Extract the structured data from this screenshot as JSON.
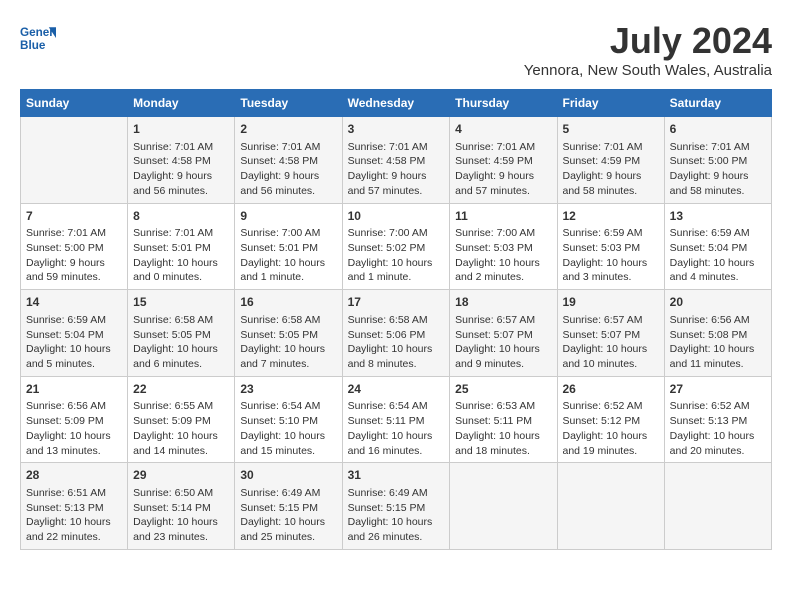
{
  "logo": {
    "line1": "General",
    "line2": "Blue"
  },
  "title": "July 2024",
  "location": "Yennora, New South Wales, Australia",
  "headers": [
    "Sunday",
    "Monday",
    "Tuesday",
    "Wednesday",
    "Thursday",
    "Friday",
    "Saturday"
  ],
  "weeks": [
    [
      {
        "day": "",
        "sunrise": "",
        "sunset": "",
        "daylight": ""
      },
      {
        "day": "1",
        "sunrise": "Sunrise: 7:01 AM",
        "sunset": "Sunset: 4:58 PM",
        "daylight": "Daylight: 9 hours and 56 minutes."
      },
      {
        "day": "2",
        "sunrise": "Sunrise: 7:01 AM",
        "sunset": "Sunset: 4:58 PM",
        "daylight": "Daylight: 9 hours and 56 minutes."
      },
      {
        "day": "3",
        "sunrise": "Sunrise: 7:01 AM",
        "sunset": "Sunset: 4:58 PM",
        "daylight": "Daylight: 9 hours and 57 minutes."
      },
      {
        "day": "4",
        "sunrise": "Sunrise: 7:01 AM",
        "sunset": "Sunset: 4:59 PM",
        "daylight": "Daylight: 9 hours and 57 minutes."
      },
      {
        "day": "5",
        "sunrise": "Sunrise: 7:01 AM",
        "sunset": "Sunset: 4:59 PM",
        "daylight": "Daylight: 9 hours and 58 minutes."
      },
      {
        "day": "6",
        "sunrise": "Sunrise: 7:01 AM",
        "sunset": "Sunset: 5:00 PM",
        "daylight": "Daylight: 9 hours and 58 minutes."
      }
    ],
    [
      {
        "day": "7",
        "sunrise": "Sunrise: 7:01 AM",
        "sunset": "Sunset: 5:00 PM",
        "daylight": "Daylight: 9 hours and 59 minutes."
      },
      {
        "day": "8",
        "sunrise": "Sunrise: 7:01 AM",
        "sunset": "Sunset: 5:01 PM",
        "daylight": "Daylight: 10 hours and 0 minutes."
      },
      {
        "day": "9",
        "sunrise": "Sunrise: 7:00 AM",
        "sunset": "Sunset: 5:01 PM",
        "daylight": "Daylight: 10 hours and 1 minute."
      },
      {
        "day": "10",
        "sunrise": "Sunrise: 7:00 AM",
        "sunset": "Sunset: 5:02 PM",
        "daylight": "Daylight: 10 hours and 1 minute."
      },
      {
        "day": "11",
        "sunrise": "Sunrise: 7:00 AM",
        "sunset": "Sunset: 5:03 PM",
        "daylight": "Daylight: 10 hours and 2 minutes."
      },
      {
        "day": "12",
        "sunrise": "Sunrise: 6:59 AM",
        "sunset": "Sunset: 5:03 PM",
        "daylight": "Daylight: 10 hours and 3 minutes."
      },
      {
        "day": "13",
        "sunrise": "Sunrise: 6:59 AM",
        "sunset": "Sunset: 5:04 PM",
        "daylight": "Daylight: 10 hours and 4 minutes."
      }
    ],
    [
      {
        "day": "14",
        "sunrise": "Sunrise: 6:59 AM",
        "sunset": "Sunset: 5:04 PM",
        "daylight": "Daylight: 10 hours and 5 minutes."
      },
      {
        "day": "15",
        "sunrise": "Sunrise: 6:58 AM",
        "sunset": "Sunset: 5:05 PM",
        "daylight": "Daylight: 10 hours and 6 minutes."
      },
      {
        "day": "16",
        "sunrise": "Sunrise: 6:58 AM",
        "sunset": "Sunset: 5:05 PM",
        "daylight": "Daylight: 10 hours and 7 minutes."
      },
      {
        "day": "17",
        "sunrise": "Sunrise: 6:58 AM",
        "sunset": "Sunset: 5:06 PM",
        "daylight": "Daylight: 10 hours and 8 minutes."
      },
      {
        "day": "18",
        "sunrise": "Sunrise: 6:57 AM",
        "sunset": "Sunset: 5:07 PM",
        "daylight": "Daylight: 10 hours and 9 minutes."
      },
      {
        "day": "19",
        "sunrise": "Sunrise: 6:57 AM",
        "sunset": "Sunset: 5:07 PM",
        "daylight": "Daylight: 10 hours and 10 minutes."
      },
      {
        "day": "20",
        "sunrise": "Sunrise: 6:56 AM",
        "sunset": "Sunset: 5:08 PM",
        "daylight": "Daylight: 10 hours and 11 minutes."
      }
    ],
    [
      {
        "day": "21",
        "sunrise": "Sunrise: 6:56 AM",
        "sunset": "Sunset: 5:09 PM",
        "daylight": "Daylight: 10 hours and 13 minutes."
      },
      {
        "day": "22",
        "sunrise": "Sunrise: 6:55 AM",
        "sunset": "Sunset: 5:09 PM",
        "daylight": "Daylight: 10 hours and 14 minutes."
      },
      {
        "day": "23",
        "sunrise": "Sunrise: 6:54 AM",
        "sunset": "Sunset: 5:10 PM",
        "daylight": "Daylight: 10 hours and 15 minutes."
      },
      {
        "day": "24",
        "sunrise": "Sunrise: 6:54 AM",
        "sunset": "Sunset: 5:11 PM",
        "daylight": "Daylight: 10 hours and 16 minutes."
      },
      {
        "day": "25",
        "sunrise": "Sunrise: 6:53 AM",
        "sunset": "Sunset: 5:11 PM",
        "daylight": "Daylight: 10 hours and 18 minutes."
      },
      {
        "day": "26",
        "sunrise": "Sunrise: 6:52 AM",
        "sunset": "Sunset: 5:12 PM",
        "daylight": "Daylight: 10 hours and 19 minutes."
      },
      {
        "day": "27",
        "sunrise": "Sunrise: 6:52 AM",
        "sunset": "Sunset: 5:13 PM",
        "daylight": "Daylight: 10 hours and 20 minutes."
      }
    ],
    [
      {
        "day": "28",
        "sunrise": "Sunrise: 6:51 AM",
        "sunset": "Sunset: 5:13 PM",
        "daylight": "Daylight: 10 hours and 22 minutes."
      },
      {
        "day": "29",
        "sunrise": "Sunrise: 6:50 AM",
        "sunset": "Sunset: 5:14 PM",
        "daylight": "Daylight: 10 hours and 23 minutes."
      },
      {
        "day": "30",
        "sunrise": "Sunrise: 6:49 AM",
        "sunset": "Sunset: 5:15 PM",
        "daylight": "Daylight: 10 hours and 25 minutes."
      },
      {
        "day": "31",
        "sunrise": "Sunrise: 6:49 AM",
        "sunset": "Sunset: 5:15 PM",
        "daylight": "Daylight: 10 hours and 26 minutes."
      },
      {
        "day": "",
        "sunrise": "",
        "sunset": "",
        "daylight": ""
      },
      {
        "day": "",
        "sunrise": "",
        "sunset": "",
        "daylight": ""
      },
      {
        "day": "",
        "sunrise": "",
        "sunset": "",
        "daylight": ""
      }
    ]
  ]
}
